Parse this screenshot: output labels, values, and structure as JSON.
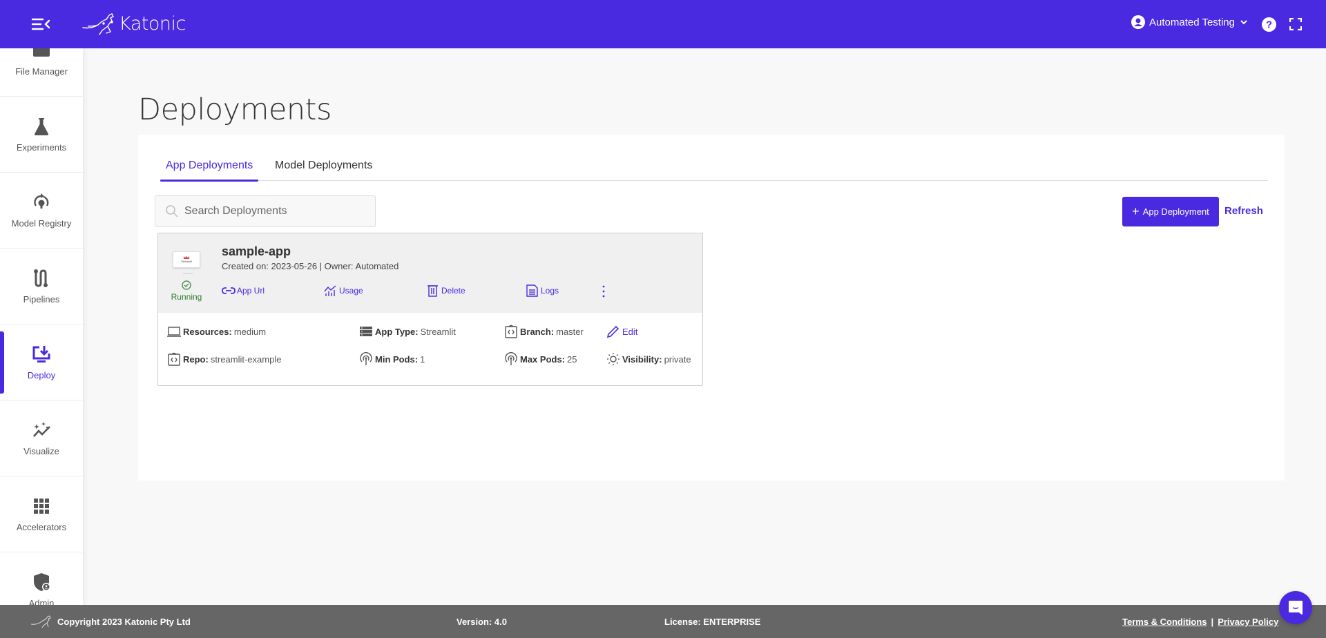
{
  "brand": {
    "name": "Katonic",
    "primary_color": "#4a2ae0"
  },
  "header": {
    "user_name": "Automated Testing",
    "icons": [
      "menu-collapse-icon",
      "user-avatar-icon",
      "chevron-down-icon",
      "help-icon",
      "fullscreen-icon"
    ]
  },
  "sidebar": {
    "items": [
      {
        "label": "File Manager",
        "icon": "folder-icon",
        "active": false
      },
      {
        "label": "Experiments",
        "icon": "flask-icon",
        "active": false
      },
      {
        "label": "Model Registry",
        "icon": "model-registry-icon",
        "active": false
      },
      {
        "label": "Pipelines",
        "icon": "pipeline-icon",
        "active": false
      },
      {
        "label": "Deploy",
        "icon": "deploy-icon",
        "active": true
      },
      {
        "label": "Visualize",
        "icon": "visualize-icon",
        "active": false
      },
      {
        "label": "Accelerators",
        "icon": "grid-icon",
        "active": false
      },
      {
        "label": "Admin",
        "icon": "admin-shield-icon",
        "active": false
      }
    ]
  },
  "main": {
    "title": "Deployments",
    "tabs": [
      {
        "label": "App Deployments",
        "active": true
      },
      {
        "label": "Model Deployments",
        "active": false
      }
    ],
    "search": {
      "placeholder": "Search Deployments",
      "value": ""
    },
    "add_button_label": "App Deployment",
    "refresh_label": "Refresh",
    "deployments": [
      {
        "name": "sample-app",
        "logo_text": "Streamlit",
        "status": "Running",
        "meta": "Created on: 2023-05-26 | Owner: Automated",
        "actions": {
          "app_url": "App Url",
          "usage": "Usage",
          "delete": "Delete",
          "logs": "Logs"
        },
        "details": {
          "resources_label": "Resources:",
          "resources": "medium",
          "app_type_label": "App Type:",
          "app_type": "Streamlit",
          "branch_label": "Branch:",
          "branch": "master",
          "edit_label": "Edit",
          "repo_label": "Repo:",
          "repo": "streamlit-example",
          "min_pods_label": "Min Pods:",
          "min_pods": "1",
          "max_pods_label": "Max Pods:",
          "max_pods": "25",
          "visibility_label": "Visibility:",
          "visibility": "private"
        }
      }
    ]
  },
  "footer": {
    "copyright": "Copyright 2023 Katonic Pty Ltd",
    "version": "Version: 4.0",
    "license": "License: ENTERPRISE",
    "terms": "Terms & Conditions",
    "separator": "|",
    "privacy": "Privacy Policy"
  }
}
